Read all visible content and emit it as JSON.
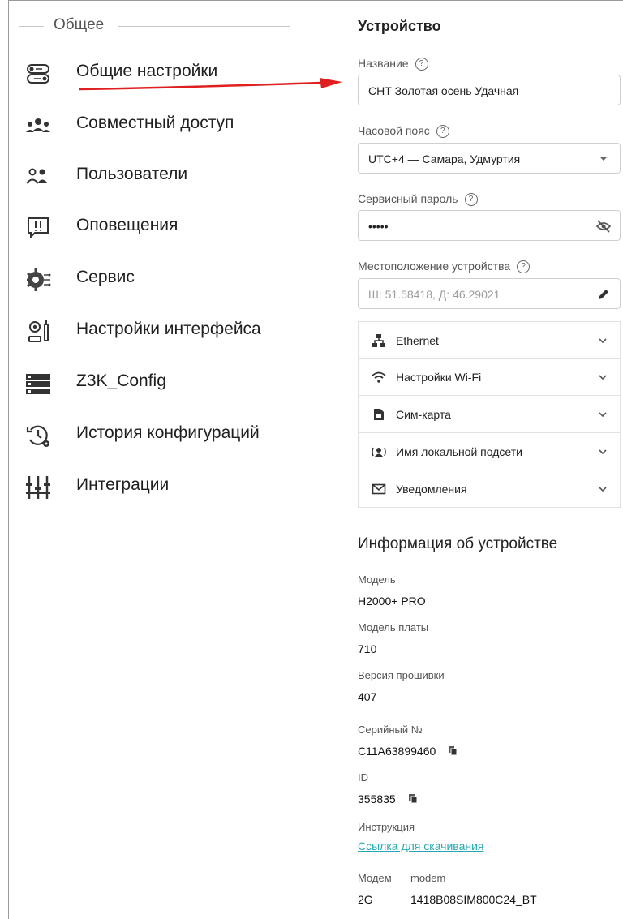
{
  "nav": {
    "section_title": "Общее",
    "items": [
      {
        "label": "Общие настройки",
        "icon": "toggle-settings-icon"
      },
      {
        "label": "Совместный доступ",
        "icon": "shared-access-icon"
      },
      {
        "label": "Пользователи",
        "icon": "users-icon"
      },
      {
        "label": "Оповещения",
        "icon": "alert-message-icon"
      },
      {
        "label": "Сервис",
        "icon": "service-gear-icon"
      },
      {
        "label": "Настройки интерфейса",
        "icon": "interface-settings-icon"
      },
      {
        "label": "Z3K_Config",
        "icon": "server-config-icon"
      },
      {
        "label": "История конфигураций",
        "icon": "history-icon"
      },
      {
        "label": "Интеграции",
        "icon": "integrations-icon"
      }
    ]
  },
  "device": {
    "heading": "Устройство",
    "name_label": "Название",
    "name_value": "СНТ Золотая осень Удачная",
    "timezone_label": "Часовой пояс",
    "timezone_value": "UTC+4 — Самара, Удмуртия",
    "password_label": "Сервисный пароль",
    "password_value": "•••••",
    "location_label": "Местоположение устройства",
    "location_placeholder": "Ш: 51.58418, Д: 46.29021"
  },
  "accordion": [
    {
      "label": "Ethernet",
      "icon": "network-icon"
    },
    {
      "label": "Настройки Wi-Fi",
      "icon": "wifi-icon"
    },
    {
      "label": "Сим-карта",
      "icon": "sim-card-icon"
    },
    {
      "label": "Имя локальной подсети",
      "icon": "local-subnet-icon"
    },
    {
      "label": "Уведомления",
      "icon": "mail-icon"
    }
  ],
  "info": {
    "title": "Информация об устройстве",
    "model_label": "Модель",
    "model_value": "H2000+ PRO",
    "board_label": "Модель платы",
    "board_value": "710",
    "firmware_label": "Версия прошивки",
    "firmware_value": "407",
    "serial_label": "Серийный №",
    "serial_value": "C11A63899460",
    "id_label": "ID",
    "id_value": "355835",
    "manual_label": "Инструкция",
    "manual_link": "Ссылка для скачивания",
    "modem_label": "Модем",
    "modem_col": "modem",
    "modem_type": "2G",
    "modem_value": "1418B08SIM800C24_BT"
  },
  "colors": {
    "link": "#25a8b5",
    "annotation_arrow": "#e02020"
  }
}
